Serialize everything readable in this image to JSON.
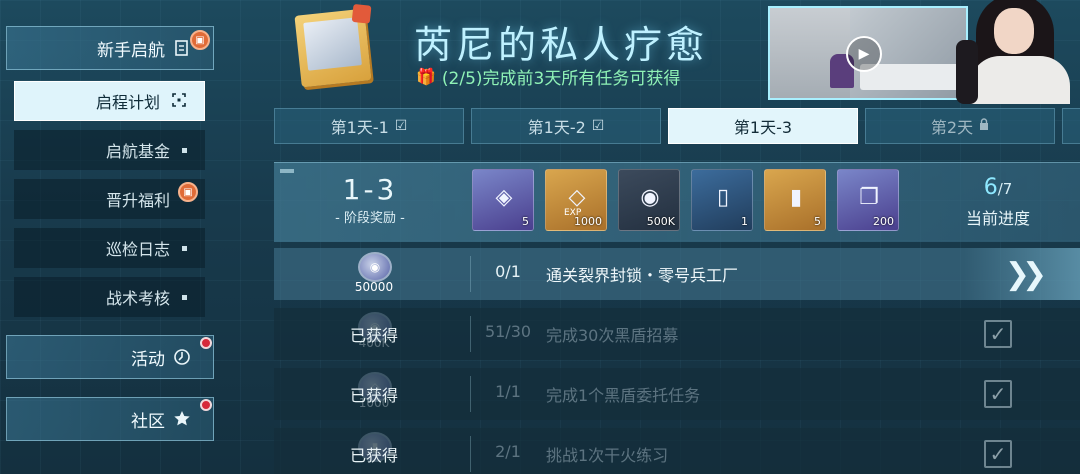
{
  "sidebar": {
    "main_items": [
      {
        "label": "新手启航",
        "icon": "document-icon",
        "badge": "gift"
      },
      {
        "label": "活动",
        "icon": "clock-icon",
        "badge": "red-dot"
      },
      {
        "label": "社区",
        "icon": "star-icon",
        "badge": "red-dot"
      }
    ],
    "sub_items": [
      {
        "label": "启程计划",
        "active": true
      },
      {
        "label": "启航基金",
        "active": false
      },
      {
        "label": "晋升福利",
        "active": false,
        "badge": "gift"
      },
      {
        "label": "巡检日志",
        "active": false
      },
      {
        "label": "战术考核",
        "active": false
      }
    ]
  },
  "banner": {
    "title": "芮尼的私人疗愈",
    "subtitle": "(2/5)完成前3天所有任务可获得"
  },
  "tabs": [
    {
      "label": "第1天-1",
      "state": "done"
    },
    {
      "label": "第1天-2",
      "state": "done"
    },
    {
      "label": "第1天-3",
      "state": "active"
    },
    {
      "label": "第2天",
      "state": "locked"
    }
  ],
  "milestone": {
    "stage": "1-3",
    "stage_label": "- 阶段奖励 -",
    "progress_current": "6",
    "progress_total": "/7",
    "progress_label": "当前进度",
    "rewards": [
      {
        "qty": "5",
        "style": "purple"
      },
      {
        "qty": "1000",
        "style": "gold",
        "tag": "EXP"
      },
      {
        "qty": "500K",
        "style": "blue"
      },
      {
        "qty": "1",
        "style": "dark"
      },
      {
        "qty": "5",
        "style": "gold"
      },
      {
        "qty": "200",
        "style": "blue"
      }
    ]
  },
  "tasks": [
    {
      "reward_qty": "50000",
      "progress": "0/1",
      "name": "通关裂界封锁・零号兵工厂",
      "done": false,
      "obtained": ""
    },
    {
      "reward_qty": "400K",
      "progress": "51/30",
      "name": "完成30次黑盾招募",
      "done": true,
      "obtained": "已获得"
    },
    {
      "reward_qty": "1000",
      "progress": "1/1",
      "name": "完成1个黑盾委托任务",
      "done": true,
      "obtained": "已获得"
    },
    {
      "reward_qty": "",
      "progress": "2/1",
      "name": "挑战1次干火练习",
      "done": true,
      "obtained": "已获得"
    }
  ],
  "colors": {
    "accent_title": "#bff1ff",
    "accent_green": "#8ff2b6",
    "progress_cyan": "#8ee8ff",
    "badge_red": "#d6293a",
    "badge_orange": "#e06b38"
  }
}
